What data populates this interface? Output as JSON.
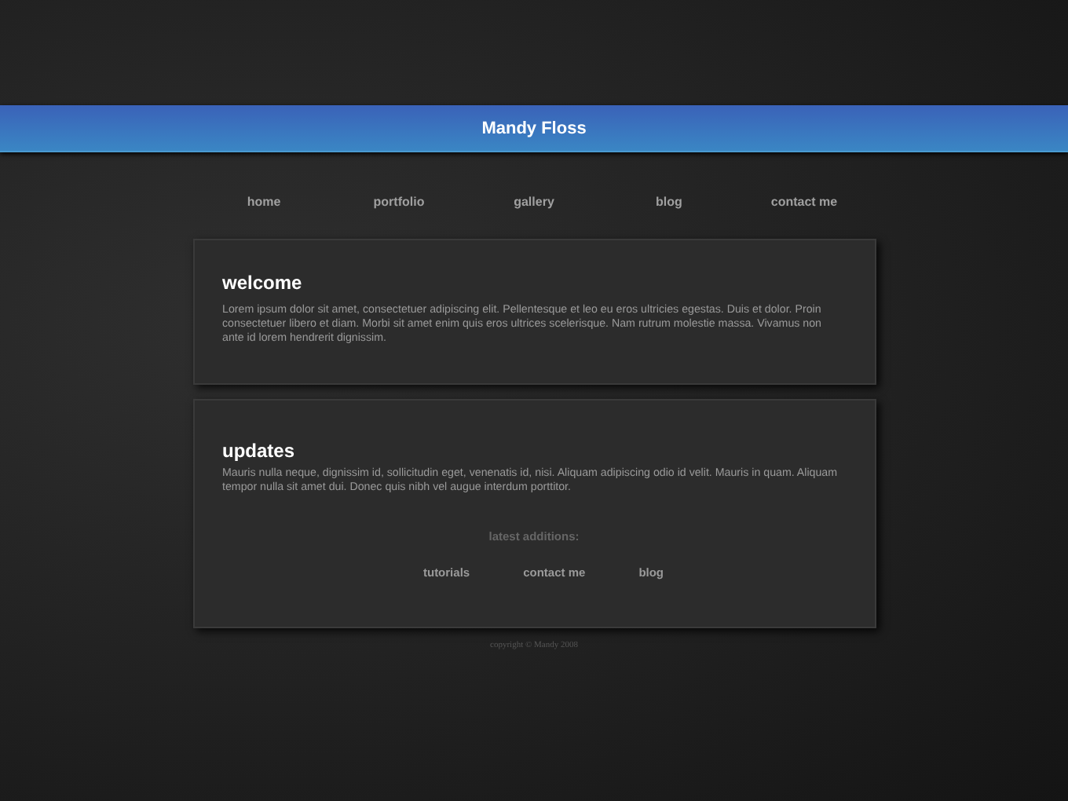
{
  "header": {
    "title": "Mandy Floss"
  },
  "nav": [
    "home",
    "portfolio",
    "gallery",
    "blog",
    "contact me"
  ],
  "welcome": {
    "heading": "welcome",
    "text": "Lorem ipsum dolor sit amet, consectetuer adipiscing elit. Pellentesque et leo eu eros ultricies egestas. Duis et dolor. Proin consectetuer libero et diam. Morbi sit amet enim quis eros ultrices scelerisque. Nam rutrum molestie massa. Vivamus non ante id lorem hendrerit dignissim."
  },
  "updates": {
    "heading": "updates",
    "text": "Mauris nulla neque, dignissim id, sollicitudin eget, venenatis id, nisi. Aliquam adipiscing odio id velit. Mauris in quam. Aliquam tempor nulla sit amet dui. Donec quis nibh vel augue interdum porttitor.",
    "latest_label": "latest additions:",
    "latest_links": [
      "tutorials",
      "contact me",
      "blog"
    ]
  },
  "footer": {
    "copyright": "copyright © Mandy 2008"
  }
}
